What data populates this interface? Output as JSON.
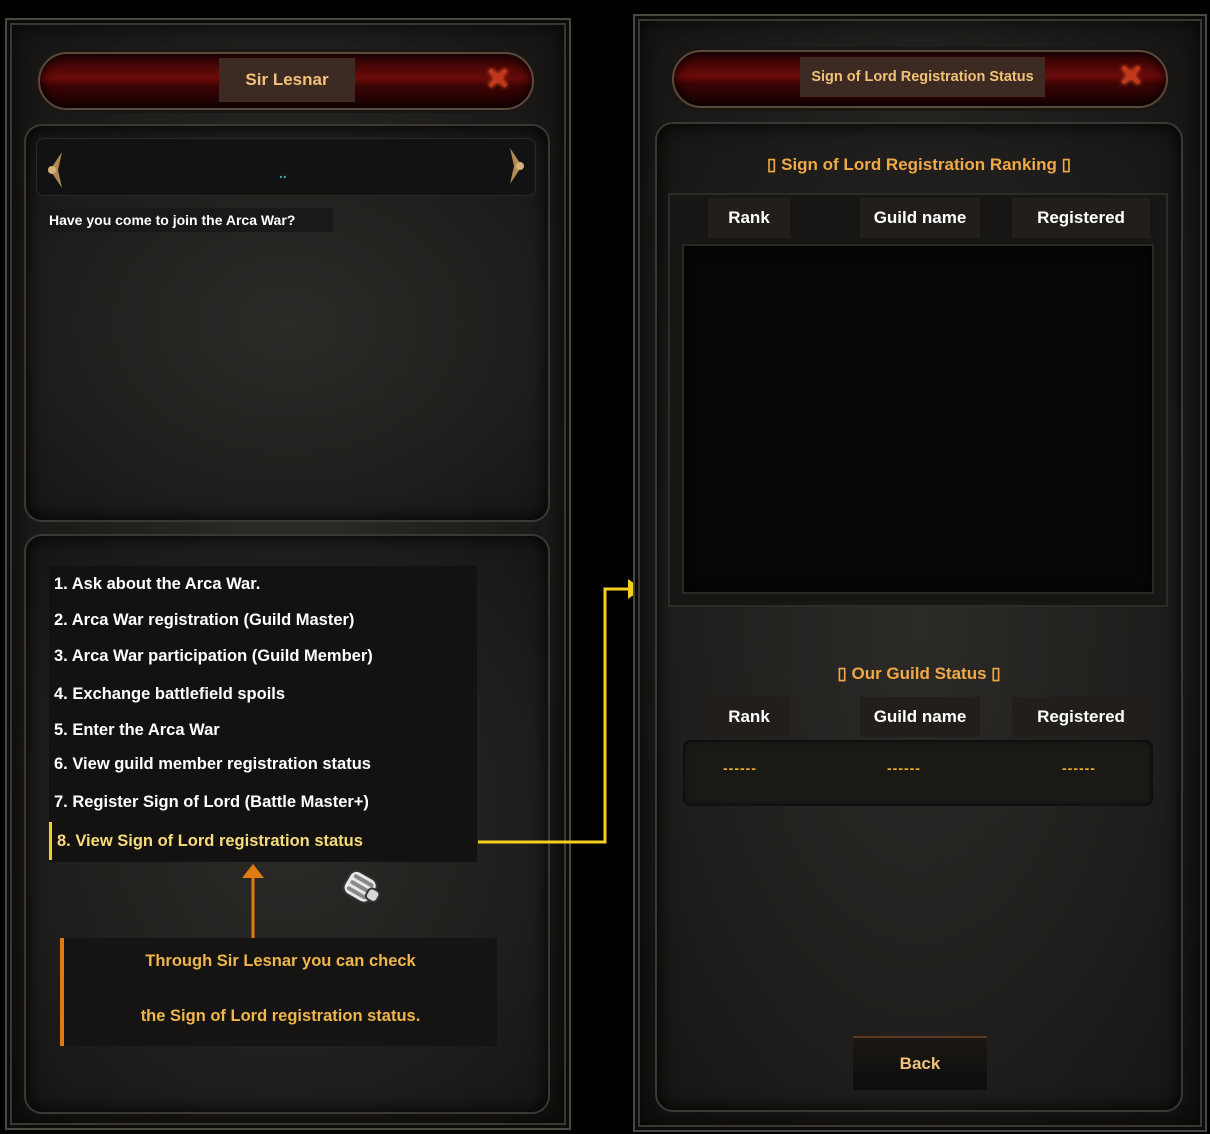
{
  "left_window": {
    "title": "Sir Lesnar",
    "close_symbol": "✕",
    "dialog_marker": "..",
    "npc_text": "Have you come to join the Arca War?",
    "menu_items": [
      "1. Ask about the Arca War.",
      "2. Arca War registration (Guild Master)",
      "3. Arca War participation (Guild Member)",
      "4. Exchange battlefield spoils",
      "5. Enter the Arca War",
      "6. View guild member registration status",
      "7. Register Sign of Lord (Battle Master+)",
      "8. View Sign of Lord registration status"
    ],
    "selected_index": 7
  },
  "callout": {
    "line1": "Through Sir Lesnar you can check",
    "line2": "the Sign of Lord registration status."
  },
  "right_window": {
    "title": "Sign of Lord Registration Status",
    "close_symbol": "✕",
    "ranking_title": "▯ Sign of Lord Registration Ranking ▯",
    "ranking_columns": [
      "Rank",
      "Guild name",
      "Registered"
    ],
    "guild_status_title": "▯ Our Guild Status ▯",
    "guild_columns": [
      "Rank",
      "Guild name",
      "Registered"
    ],
    "guild_values": [
      "------",
      "------",
      "------"
    ],
    "back_label": "Back"
  },
  "colors": {
    "title_text": "#f2c27a",
    "selected_text": "#f7dc7a",
    "highlight_border": "#f5d020",
    "callout_text": "#f0b64a",
    "callout_accent": "#e07a12",
    "arrow_yellow": "#f5d020",
    "arrow_orange": "#e07a12"
  },
  "icons": [
    "close-icon",
    "ornament-left-icon",
    "ornament-right-icon",
    "hand-cursor-icon"
  ]
}
